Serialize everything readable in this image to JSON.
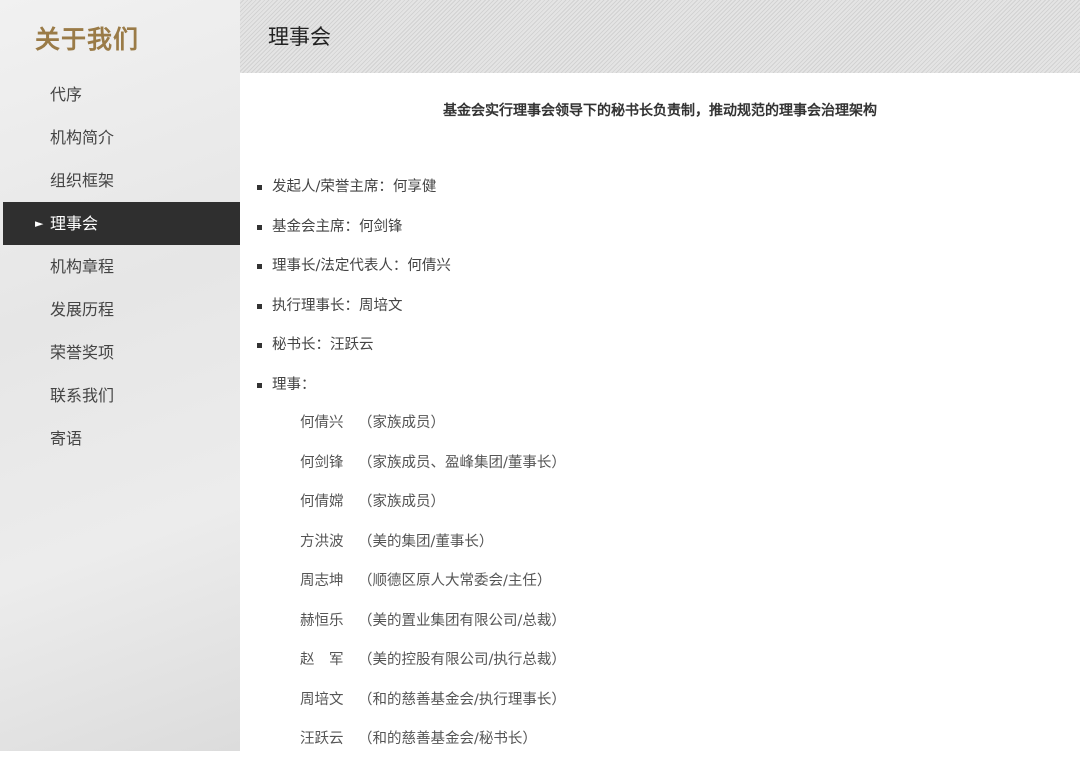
{
  "sidebar": {
    "title": "关于我们",
    "items": [
      {
        "label": "代序"
      },
      {
        "label": "机构简介"
      },
      {
        "label": "组织框架"
      },
      {
        "label": "理事会",
        "active": true
      },
      {
        "label": "机构章程"
      },
      {
        "label": "发展历程"
      },
      {
        "label": "荣誉奖项"
      },
      {
        "label": "联系我们"
      },
      {
        "label": "寄语"
      }
    ]
  },
  "header": {
    "title": "理事会"
  },
  "main": {
    "intro": "基金会实行理事会领导下的秘书长负责制，推动规范的理事会治理架构",
    "roles": [
      "发起人/荣誉主席：何享健",
      "基金会主席：何剑锋",
      "理事长/法定代表人：何倩兴",
      "执行理事长：周培文",
      "秘书长：汪跃云",
      "理事："
    ],
    "members": [
      {
        "name": "何倩兴",
        "desc": "（家族成员）"
      },
      {
        "name": "何剑锋",
        "desc": "（家族成员、盈峰集团/董事长）"
      },
      {
        "name": "何倩嫦",
        "desc": "（家族成员）"
      },
      {
        "name": "方洪波",
        "desc": "（美的集团/董事长）"
      },
      {
        "name": "周志坤",
        "desc": "（顺德区原人大常委会/主任）"
      },
      {
        "name": "赫恒乐",
        "desc": "（美的置业集团有限公司/总裁）"
      },
      {
        "name": "赵　军",
        "desc": "（美的控股有限公司/执行总裁）"
      },
      {
        "name": "周培文",
        "desc": "（和的慈善基金会/执行理事长）"
      },
      {
        "name": "汪跃云",
        "desc": "（和的慈善基金会/秘书长）"
      }
    ]
  }
}
